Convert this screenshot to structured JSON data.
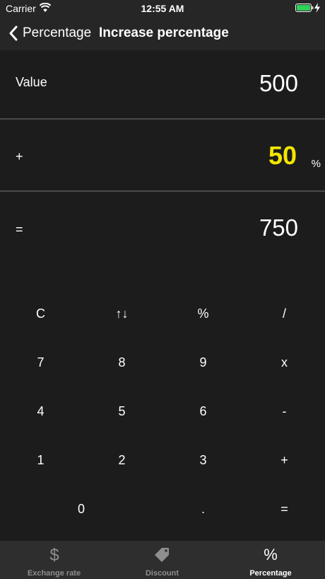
{
  "status_bar": {
    "carrier": "Carrier",
    "time": "12:55 AM",
    "icons": [
      "wifi-icon",
      "battery-icon",
      "charging-bolt-icon"
    ],
    "battery_color": "#2fd158"
  },
  "nav": {
    "back_label": "Percentage",
    "title": "Increase percentage"
  },
  "calc": {
    "value_label": "Value",
    "value": "500",
    "operator_label": "+",
    "percent_value": "50",
    "percent_unit": "%",
    "result_label": "=",
    "result_value": "750",
    "highlight_color": "#f2e600"
  },
  "keypad": {
    "clear": "C",
    "swap": "↑↓",
    "percent": "%",
    "divide": "/",
    "seven": "7",
    "eight": "8",
    "nine": "9",
    "multiply": "x",
    "four": "4",
    "five": "5",
    "six": "6",
    "minus": "-",
    "one": "1",
    "two": "2",
    "three": "3",
    "plus": "+",
    "zero": "0",
    "decimal": ".",
    "equals": "="
  },
  "tabs": [
    {
      "label": "Exchange rate",
      "icon": "dollar-icon",
      "active": false
    },
    {
      "label": "Discount",
      "icon": "sale-tag-icon",
      "active": false
    },
    {
      "label": "Percentage",
      "icon": "percent-icon",
      "active": true
    }
  ]
}
